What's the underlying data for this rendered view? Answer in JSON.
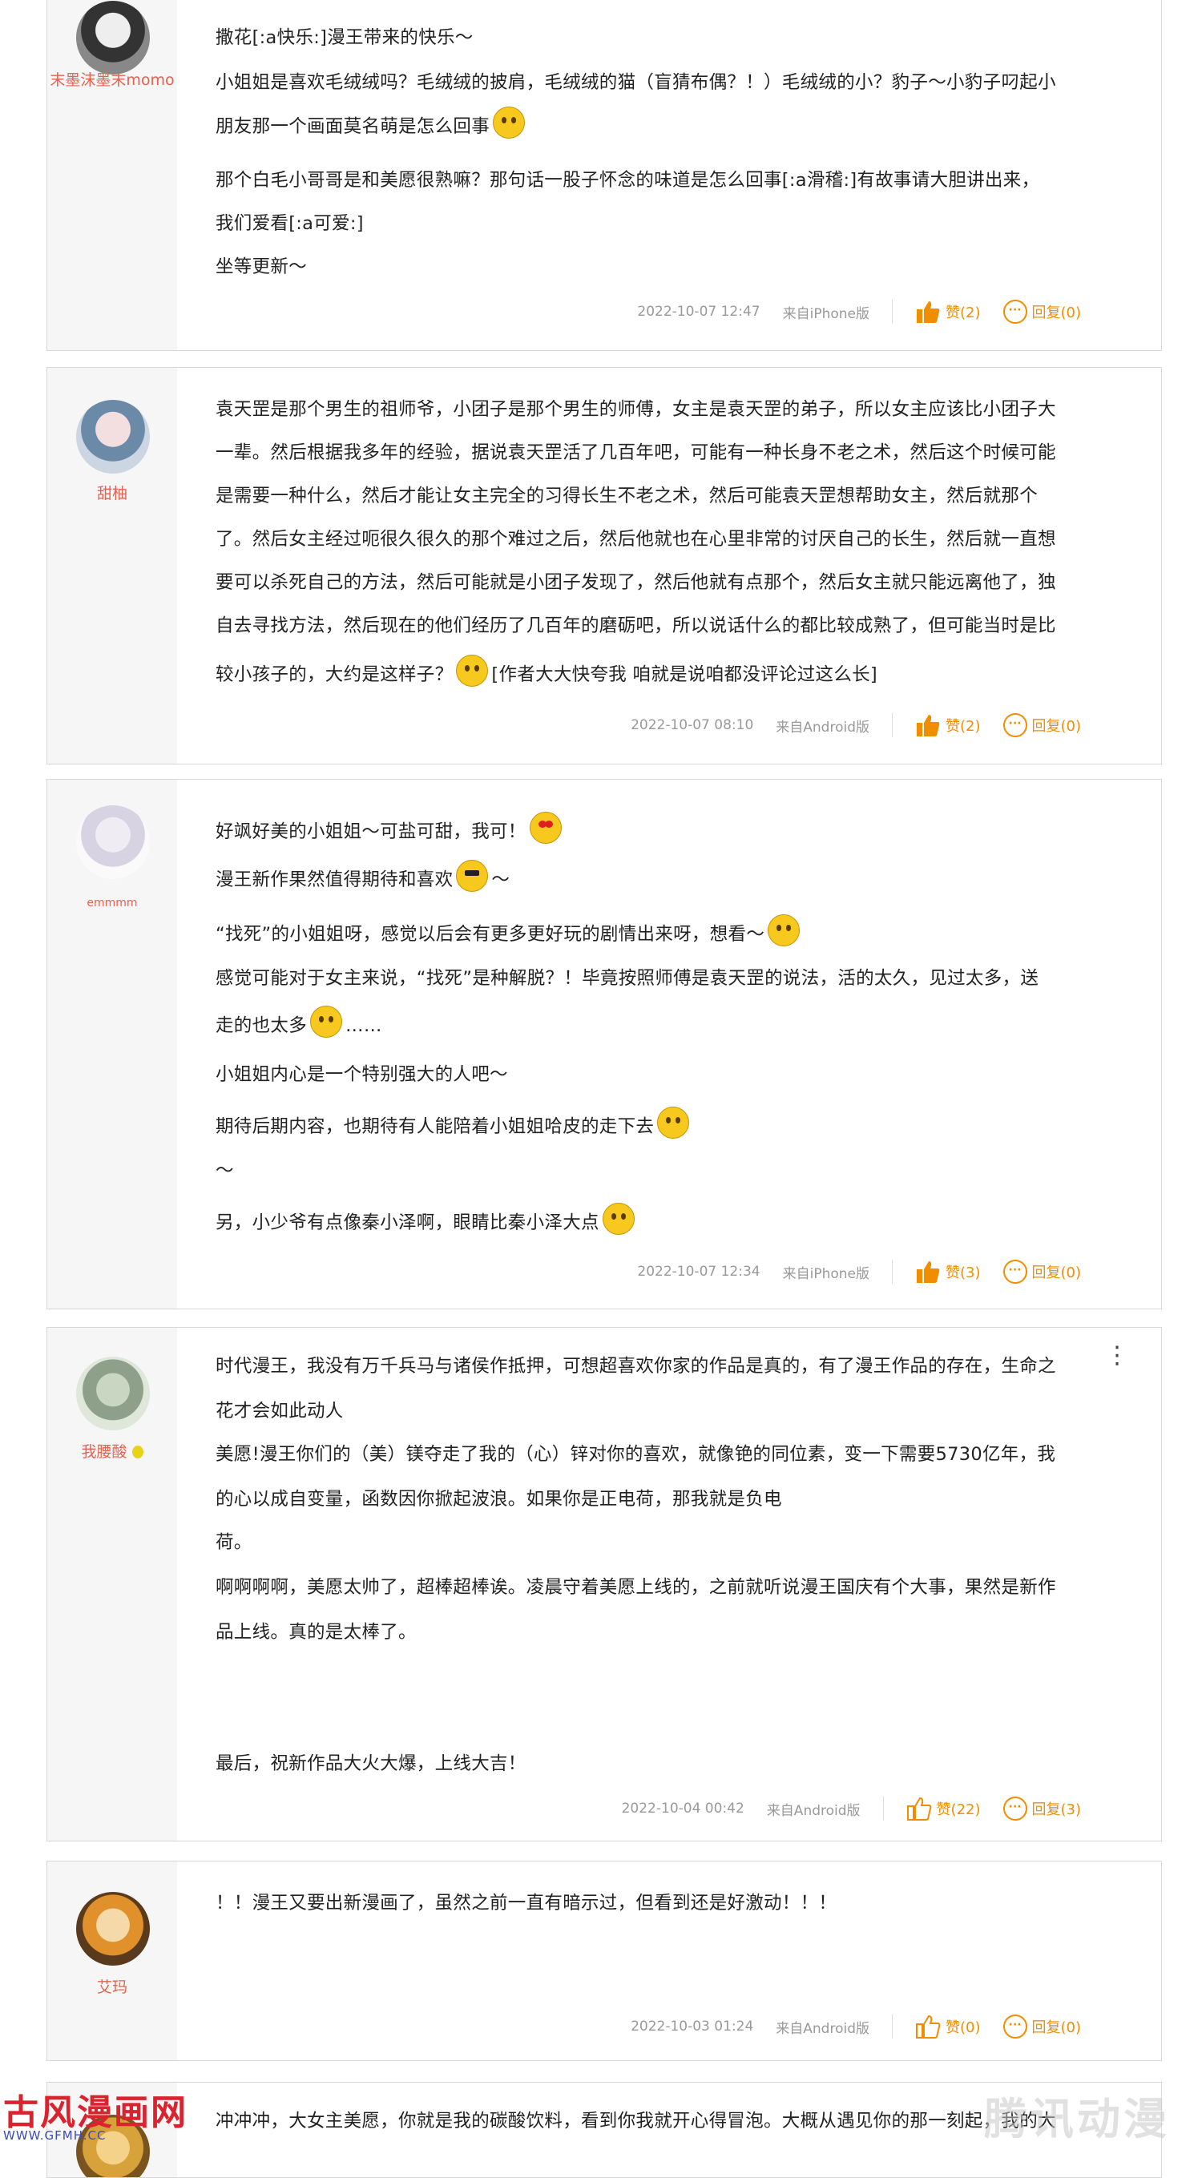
{
  "comments": [
    {
      "user": "末墨沫墨末momo",
      "lines": [
        {
          "text": "撒花[:a快乐:]漫王带来的快乐～"
        },
        {
          "text": "小姐姐是喜欢毛绒绒吗？毛绒绒的披肩，毛绒绒的猫（盲猜布偶？！）毛绒绒的小？豹子～小豹子叼起小"
        },
        {
          "text": "朋友那一个画面莫名萌是怎么回事",
          "emoji": "dizzy-emoji"
        },
        {
          "text": "那个白毛小哥哥是和美愿很熟嘛？那句话一股子怀念的味道是怎么回事[:a滑稽:]有故事请大胆讲出来，"
        },
        {
          "text": "我们爱看[:a可爱:]"
        },
        {
          "text": "坐等更新～"
        }
      ],
      "time": "2022-10-07 12:47",
      "source": "来自iPhone版",
      "like_label": "赞(2)",
      "reply_label": "回复(0)"
    },
    {
      "user": "甜柚",
      "lines": [
        {
          "text": "袁天罡是那个男生的祖师爷，小团子是那个男生的师傅，女主是袁天罡的弟子，所以女主应该比小团子大"
        },
        {
          "text": "一辈。然后根据我多年的经验，据说袁天罡活了几百年吧，可能有一种长身不老之术，然后这个时候可能"
        },
        {
          "text": "是需要一种什么，然后才能让女主完全的习得长生不老之术，然后可能袁天罡想帮助女主，然后就那个"
        },
        {
          "text": "了。然后女主经过呃很久很久的那个难过之后，然后他就也在心里非常的讨厌自己的长生，然后就一直想"
        },
        {
          "text": "要可以杀死自己的方法，然后可能就是小团子发现了，然后他就有点那个，然后女主就只能远离他了，独"
        },
        {
          "text": "自去寻找方法，然后现在的他们经历了几百年的磨砺吧，所以说话什么的都比较成熟了，但可能当时是比"
        },
        {
          "text": "较小孩子的，大约是这样子？",
          "emoji": "grin-emoji",
          "after": "[作者大大快夸我 咱就是说咱都没评论过这么长]"
        }
      ],
      "time": "2022-10-07 08:10",
      "source": "来自Android版",
      "like_label": "赞(2)",
      "reply_label": "回复(0)"
    },
    {
      "user": "emmmm",
      "lines": [
        {
          "text": "好飒好美的小姐姐～可盐可甜，我可！",
          "emoji": "heart-eyes-emoji"
        },
        {
          "text": "漫王新作果然值得期待和喜欢",
          "emoji": "cool-emoji",
          "after": "～"
        },
        {
          "text": "“找死”的小姐姐呀，感觉以后会有更多更好玩的剧情出来呀，想看～",
          "emoji": "smile-emoji"
        },
        {
          "text": "感觉可能对于女主来说，“找死”是种解脱？！毕竟按照师傅是袁天罡的说法，活的太久，见过太多，送"
        },
        {
          "text": "走的也太多",
          "emoji": "dizzy-emoji",
          "after": "……"
        },
        {
          "text": "小姐姐内心是一个特别强大的人吧～"
        },
        {
          "text": "期待后期内容，也期待有人能陪着小姐姐哈皮的走下去",
          "emoji": "grin-emoji"
        },
        {
          "text": "～"
        },
        {
          "text": "另，小少爷有点像秦小泽啊，眼睛比秦小泽大点",
          "emoji": "grin-emoji"
        }
      ],
      "time": "2022-10-07 12:34",
      "source": "来自iPhone版",
      "like_label": "赞(3)",
      "reply_label": "回复(0)"
    },
    {
      "user": "我腰酸",
      "lines": [
        {
          "text": "时代漫王，我没有万千兵马与诸侯作抵押，可想超喜欢你家的作品是真的，有了漫王作品的存在，生命之"
        },
        {
          "text": "花才会如此动人"
        },
        {
          "text": "美愿!漫王你们的（美）镁夺走了我的（心）锌对你的喜欢，就像铯的同位素，变一下需要5730亿年，我"
        },
        {
          "text": "的心以成自变量，函数因你掀起波浪。如果你是正电荷，那我就是负电"
        },
        {
          "text": "荷。"
        },
        {
          "text": "啊啊啊啊，美愿太帅了，超棒超棒诶。凌晨守着美愿上线的，之前就听说漫王国庆有个大事，果然是新作"
        },
        {
          "text": "品上线。真的是太棒了。"
        },
        {
          "text": ""
        },
        {
          "text": ""
        },
        {
          "text": "最后，祝新作品大火大爆，上线大吉！"
        }
      ],
      "time": "2022-10-04 00:42",
      "source": "来自Android版",
      "like_label": "赞(22)",
      "reply_label": "回复(3)"
    },
    {
      "user": "艾玛",
      "lines": [
        {
          "text": "！！漫王又要出新漫画了，虽然之前一直有暗示过，但看到还是好激动！！！"
        }
      ],
      "time": "2022-10-03 01:24",
      "source": "来自Android版",
      "like_label": "赞(0)",
      "reply_label": "回复(0)"
    },
    {
      "user": "",
      "lines": [
        {
          "text": "冲冲冲，大女主美愿，你就是我的碳酸饮料，看到你我就开心得冒泡。大概从遇见你的那一刻起，我的大"
        }
      ],
      "time": "",
      "source": "",
      "like_label": "",
      "reply_label": ""
    }
  ],
  "watermark_left": {
    "title": "古风漫画网",
    "url": "WWW.GFMH.CC"
  },
  "watermark_right": "腾讯动漫",
  "colors": {
    "username": "#e4624e",
    "action": "#f18d00",
    "meta": "#999999"
  }
}
